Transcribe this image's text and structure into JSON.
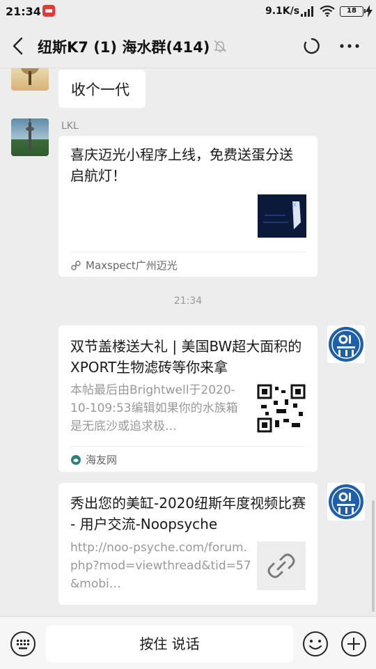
{
  "status_bar": {
    "time": "21:34",
    "net_speed": "9.1K/s",
    "battery": "18"
  },
  "header": {
    "title": "纽斯K7 (1) 海水群(414)",
    "icons": [
      "back-icon",
      "mute-icon",
      "refresh-icon",
      "more-icon"
    ]
  },
  "messages": {
    "msg1": {
      "text": "收个一代"
    },
    "msg2": {
      "sender": "LKL",
      "title": "喜庆迈光小程序上线，免费送蛋分送启航灯！",
      "source": "Maxspect广州迈光"
    },
    "timestamp": "21:34",
    "msg3": {
      "title": "双节盖楼送大礼 | 美国BW超大面积的XPORT生物滤砖等你来拿",
      "desc": "本帖最后由Brightwell于2020-10-109:53编辑如果你的水族箱是无底沙或追求极…",
      "source": "海友网"
    },
    "msg4": {
      "title": "秀出您的美缸-2020纽斯年度视频比赛 - 用户交流-Noopsyche",
      "desc": "http://noo-psyche.com/forum.php?mod=viewthread&tid=57&mobi…"
    }
  },
  "input_bar": {
    "talk_label": "按住 说话"
  },
  "colors": {
    "background": "#ededed",
    "bubble": "#ffffff",
    "text": "#191919",
    "muted": "#999999",
    "brand_blue": "#1f5fa8"
  }
}
